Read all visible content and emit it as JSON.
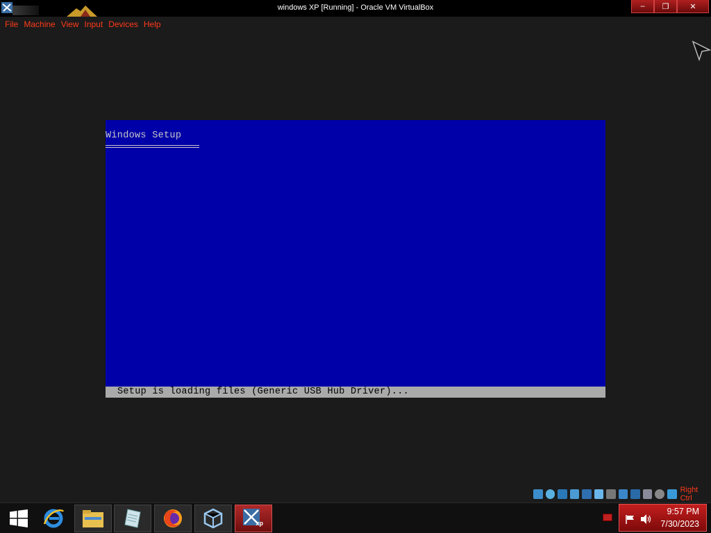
{
  "window": {
    "title": "windows XP [Running] - Oracle VM VirtualBox",
    "minimize_glyph": "‒",
    "maximize_glyph": "❐",
    "close_glyph": "✕"
  },
  "menu": {
    "items": [
      {
        "label": "File"
      },
      {
        "label": "Machine"
      },
      {
        "label": "View"
      },
      {
        "label": "Input"
      },
      {
        "label": "Devices"
      },
      {
        "label": "Help"
      }
    ]
  },
  "guest": {
    "setup_title": "Windows Setup",
    "status_text": "Setup is loading files (Generic USB Hub Driver)..."
  },
  "vbox_status": {
    "icons": [
      "hard-disk-icon",
      "optical-drive-icon",
      "audio-icon",
      "network-icon",
      "usb-icon",
      "shared-folders-icon",
      "display-icon",
      "video-capture-icon",
      "recording-icon",
      "cpu-icon",
      "mouse-integration-icon",
      "keyboard-icon"
    ],
    "host_key_label": "Right Ctrl"
  },
  "taskbar": {
    "buttons": [
      "start-icon",
      "internet-explorer-icon",
      "file-explorer-icon",
      "notepad-icon",
      "firefox-icon",
      "virtualbox-icon",
      "virtualbox-vm-xp-icon"
    ],
    "vm_badge": "XP"
  },
  "clock": {
    "time": "9:57 PM",
    "date": "7/30/2023"
  },
  "colors": {
    "menu_text": "#ff3a1a",
    "guest_bg": "#0000a8",
    "guest_status_bg": "#aaaaaa",
    "taskbar_active": "#b02a2a"
  }
}
